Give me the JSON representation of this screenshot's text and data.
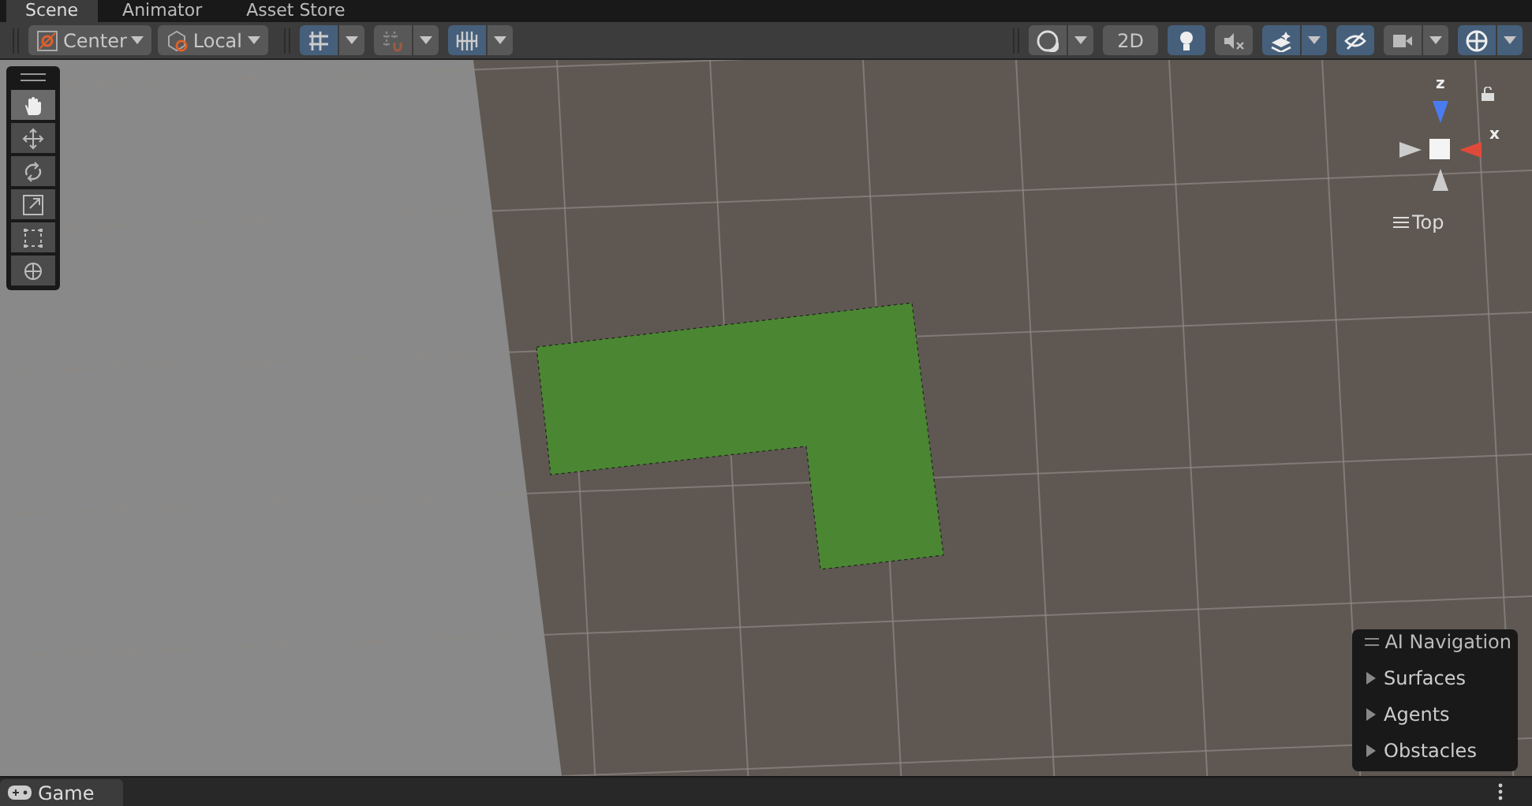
{
  "tabs": [
    {
      "label": "Scene",
      "selected": true
    },
    {
      "label": "Animator",
      "selected": false
    },
    {
      "label": "Asset Store",
      "selected": false
    }
  ],
  "toolbar": {
    "pivot": "Center",
    "space": "Local",
    "snap_buttons": [
      {
        "kind": "grid",
        "on": true
      },
      {
        "kind": "snap",
        "on": false
      },
      {
        "kind": "increment",
        "on": true
      }
    ],
    "view_buttons": [
      {
        "kind": "shading",
        "on": false,
        "dropdown": true
      },
      {
        "kind": "text",
        "label": "2D",
        "on": false,
        "dropdown": false
      },
      {
        "kind": "light",
        "on": true,
        "dropdown": false
      },
      {
        "kind": "audio",
        "on": false,
        "dropdown": false
      },
      {
        "kind": "effects",
        "on": true,
        "dropdown": true
      },
      {
        "kind": "visibility",
        "on": true,
        "dropdown": false
      },
      {
        "kind": "camera",
        "on": false,
        "dropdown": true
      },
      {
        "kind": "gizmos",
        "on": true,
        "dropdown": true
      }
    ]
  },
  "tools": [
    {
      "kind": "hand",
      "selected": true
    },
    {
      "kind": "move",
      "selected": false
    },
    {
      "kind": "rotate",
      "selected": false
    },
    {
      "kind": "scale",
      "selected": false
    },
    {
      "kind": "rect",
      "selected": false
    },
    {
      "kind": "transform",
      "selected": false
    }
  ],
  "gizmo": {
    "z_label": "z",
    "x_label": "x",
    "view_label": "Top"
  },
  "ai_navigation": {
    "title": "AI Navigation",
    "items": [
      {
        "label": "Surfaces",
        "expanded": false
      },
      {
        "label": "Agents",
        "expanded": false
      },
      {
        "label": "Obstacles",
        "expanded": false
      }
    ]
  },
  "bottom_tabs": [
    {
      "label": "Game",
      "selected": true
    }
  ]
}
